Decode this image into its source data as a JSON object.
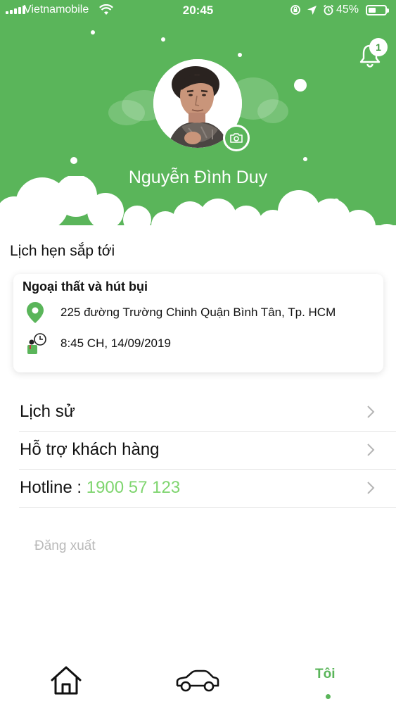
{
  "status_bar": {
    "carrier": "Vietnamobile",
    "time": "20:45",
    "battery_percent": "45%",
    "battery_level": 0.45
  },
  "header": {
    "notification_count": "1",
    "user_name": "Nguyễn Đình Duy",
    "background_color": "#5ab55a"
  },
  "appointments": {
    "section_title": "Lịch hẹn sắp tới",
    "card": {
      "service": "Ngoại thất và hút bụi",
      "address": "225 đường Trường Chinh Quận Bình Tân, Tp. HCM",
      "datetime": "8:45 CH, 14/09/2019"
    }
  },
  "menu": {
    "history": "Lịch sử",
    "support": "Hỗ trợ khách hàng",
    "hotline_label": "Hotline : ",
    "hotline_number": "1900 57 123"
  },
  "logout_label": "Đăng xuất",
  "tabbar": {
    "me_label": "Tôi",
    "active_tab": "Tôi",
    "active_color": "#5ab55a"
  },
  "icons": {
    "signal": "signal-icon",
    "wifi": "wifi-icon",
    "bell": "bell-icon",
    "camera": "camera-icon",
    "location": "location-pin-icon",
    "clock": "clock-person-icon",
    "chevron": "chevron-right-icon",
    "home": "home-icon",
    "car": "car-icon"
  }
}
